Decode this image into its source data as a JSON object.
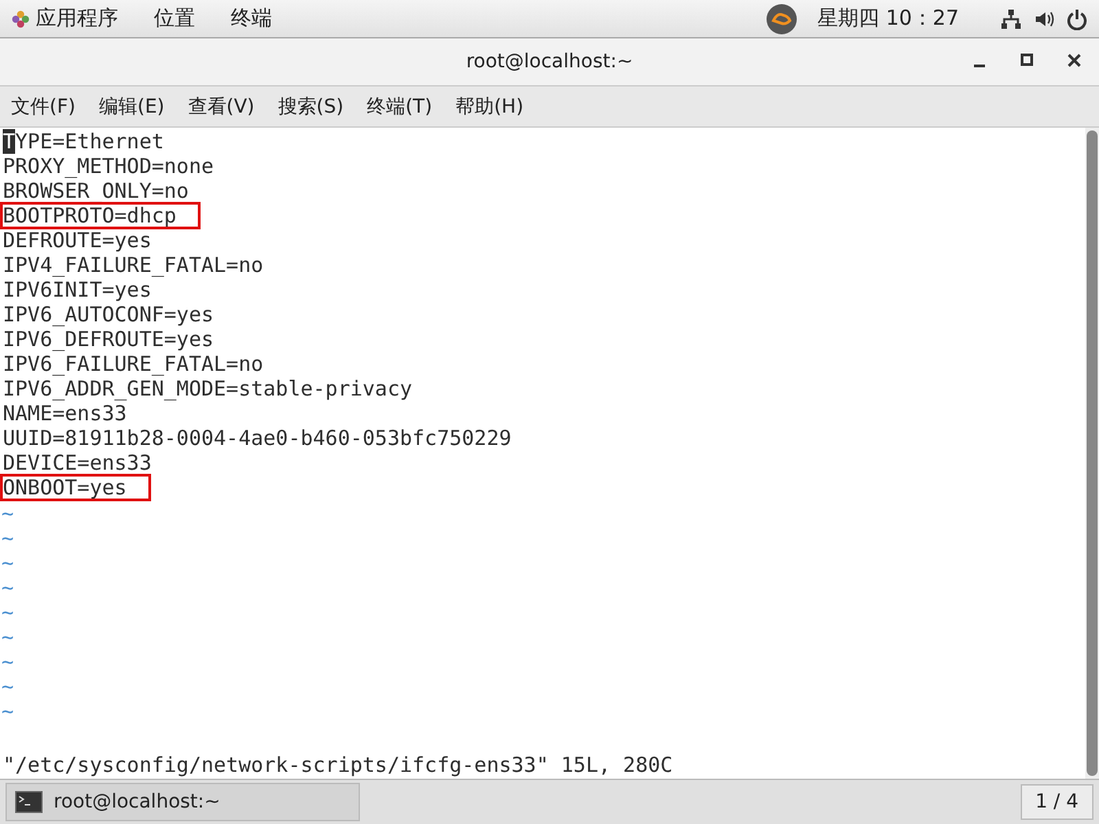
{
  "top_bar": {
    "menus": [
      "应用程序",
      "位置",
      "终端"
    ],
    "clock": "星期四 10：27"
  },
  "window": {
    "title": "root@localhost:~"
  },
  "menu_bar": [
    "文件(F)",
    "编辑(E)",
    "查看(V)",
    "搜索(S)",
    "终端(T)",
    "帮助(H)"
  ],
  "editor": {
    "lines": [
      {
        "text": "TYPE=Ethernet",
        "cursor": true,
        "highlighted": false
      },
      {
        "text": "PROXY_METHOD=none",
        "cursor": false,
        "highlighted": false
      },
      {
        "text": "BROWSER_ONLY=no",
        "cursor": false,
        "highlighted": false
      },
      {
        "text": "BOOTPROTO=dhcp",
        "cursor": false,
        "highlighted": true
      },
      {
        "text": "DEFROUTE=yes",
        "cursor": false,
        "highlighted": false
      },
      {
        "text": "IPV4_FAILURE_FATAL=no",
        "cursor": false,
        "highlighted": false
      },
      {
        "text": "IPV6INIT=yes",
        "cursor": false,
        "highlighted": false
      },
      {
        "text": "IPV6_AUTOCONF=yes",
        "cursor": false,
        "highlighted": false
      },
      {
        "text": "IPV6_DEFROUTE=yes",
        "cursor": false,
        "highlighted": false
      },
      {
        "text": "IPV6_FAILURE_FATAL=no",
        "cursor": false,
        "highlighted": false
      },
      {
        "text": "IPV6_ADDR_GEN_MODE=stable-privacy",
        "cursor": false,
        "highlighted": false
      },
      {
        "text": "NAME=ens33",
        "cursor": false,
        "highlighted": false
      },
      {
        "text": "UUID=81911b28-0004-4ae0-b460-053bfc750229",
        "cursor": false,
        "highlighted": false
      },
      {
        "text": "DEVICE=ens33",
        "cursor": false,
        "highlighted": false
      },
      {
        "text": "ONBOOT=yes",
        "cursor": false,
        "highlighted": true
      }
    ],
    "empty_line_marks": [
      "~",
      "~",
      "~",
      "~",
      "~",
      "~",
      "~",
      "~",
      "~"
    ],
    "status_line": "\"/etc/sysconfig/network-scripts/ifcfg-ens33\" 15L, 280C"
  },
  "taskbar": {
    "task": "root@localhost:~",
    "workspace": "1 / 4"
  }
}
